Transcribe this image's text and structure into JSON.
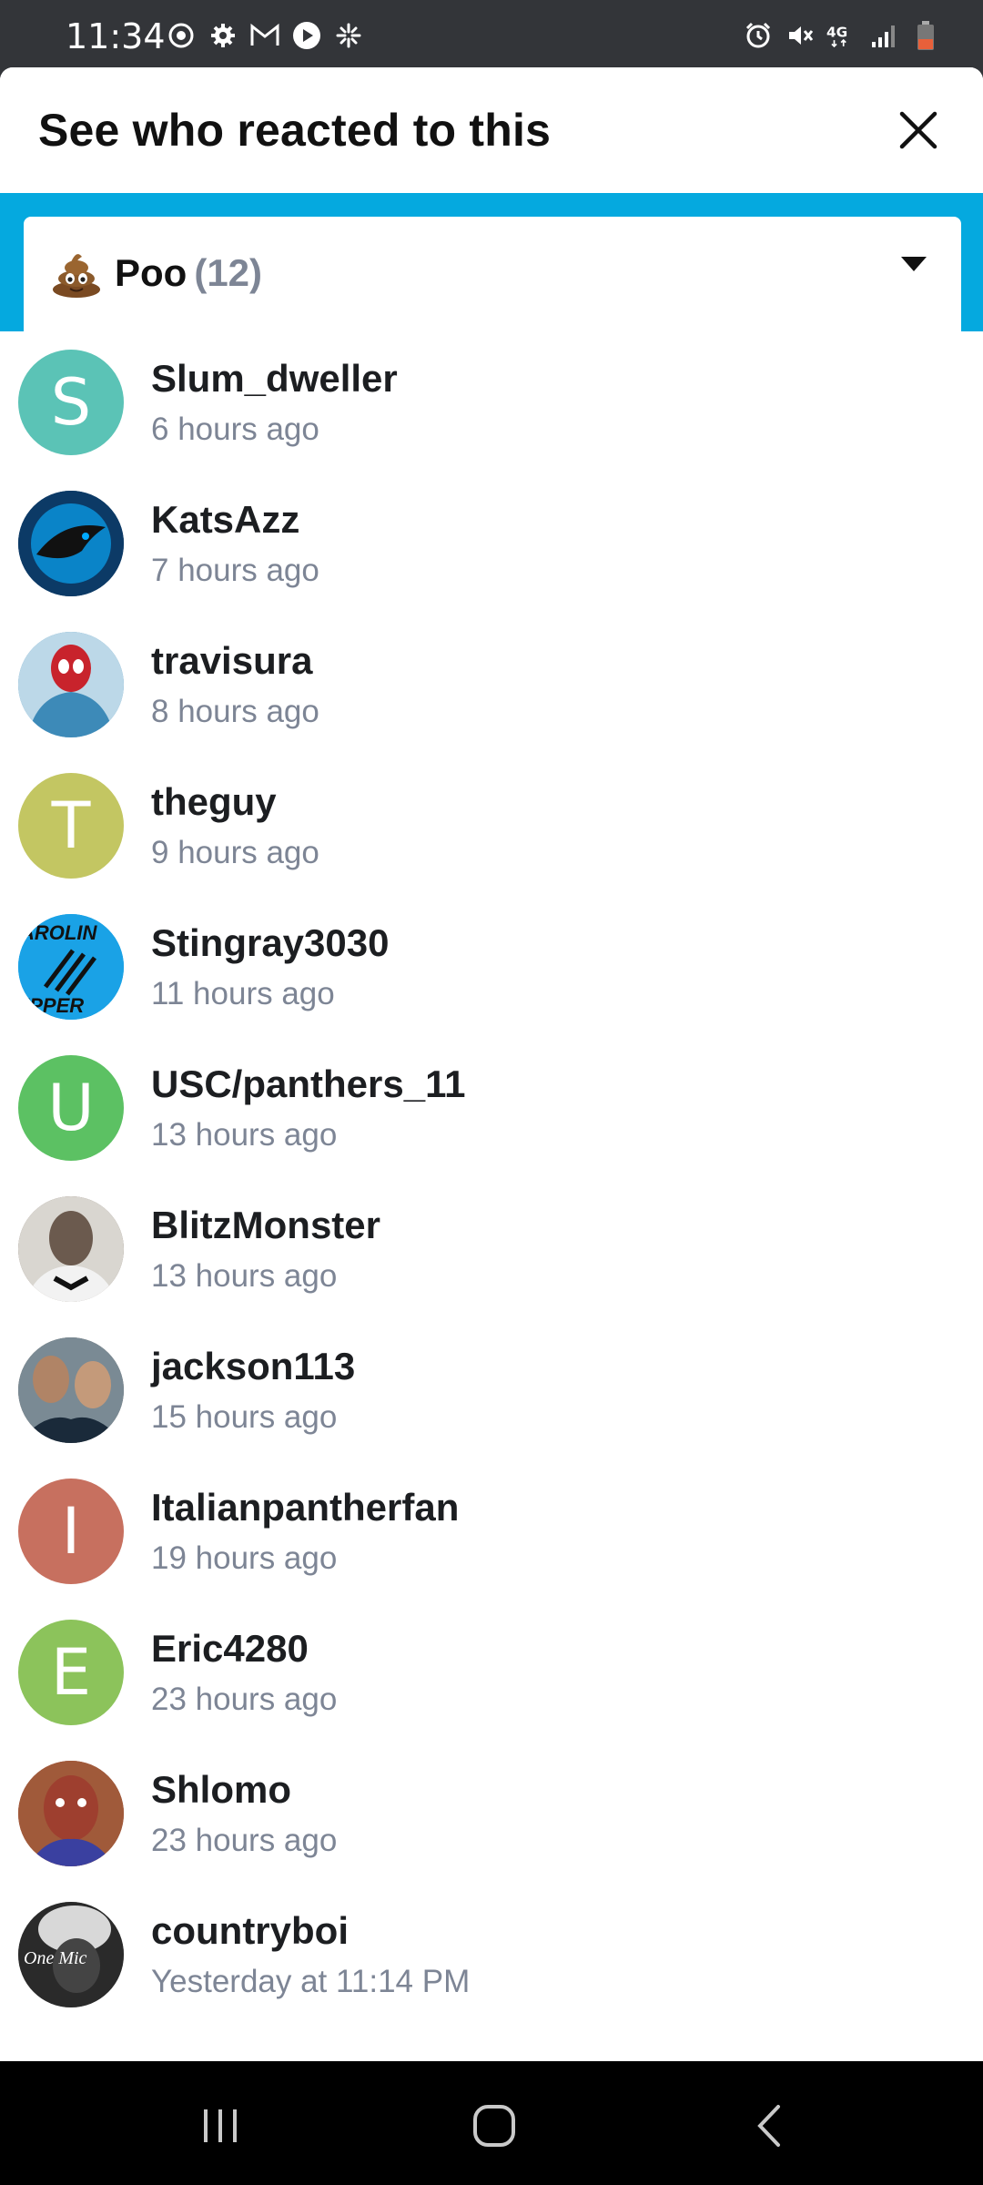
{
  "status_bar": {
    "time": "11:34",
    "left_icons": [
      "whatsapp-icon",
      "settings-icon",
      "gmail-icon",
      "play-icon",
      "sparkle-icon"
    ],
    "right_icons": [
      "alarm-icon",
      "mute-icon",
      "4g-icon",
      "signal-icon",
      "battery-icon"
    ]
  },
  "sheet": {
    "title": "See who reacted to this"
  },
  "reaction_filter": {
    "emoji": "poo-icon",
    "name": "Poo",
    "count": "(12)"
  },
  "reactors": [
    {
      "username": "Slum_dweller",
      "time": "6 hours ago",
      "initial": "S",
      "color": "#5bc3b6",
      "avatar": "letter"
    },
    {
      "username": "KatsAzz",
      "time": "7 hours ago",
      "initial": "",
      "color": "#0c3a66",
      "avatar": "panthers-logo"
    },
    {
      "username": "travisura",
      "time": "8 hours ago",
      "initial": "",
      "color": "#3d8ab8",
      "avatar": "spiderman"
    },
    {
      "username": "theguy",
      "time": "9 hours ago",
      "initial": "T",
      "color": "#c3c662",
      "avatar": "letter"
    },
    {
      "username": "Stingray3030",
      "time": "11 hours ago",
      "initial": "",
      "color": "#1aa2e6",
      "avatar": "carolina-clippers"
    },
    {
      "username": "USC/panthers_11",
      "time": "13 hours ago",
      "initial": "U",
      "color": "#5cc163",
      "avatar": "letter"
    },
    {
      "username": "BlitzMonster",
      "time": "13 hours ago",
      "initial": "",
      "color": "#6b5a4e",
      "avatar": "player-photo"
    },
    {
      "username": "jackson113",
      "time": "15 hours ago",
      "initial": "",
      "color": "#5a5550",
      "avatar": "players-photo"
    },
    {
      "username": "Italianpantherfan",
      "time": "19 hours ago",
      "initial": "I",
      "color": "#c7705f",
      "avatar": "letter"
    },
    {
      "username": "Eric4280",
      "time": "23 hours ago",
      "initial": "E",
      "color": "#8cc35b",
      "avatar": "letter"
    },
    {
      "username": "Shlomo",
      "time": "23 hours ago",
      "initial": "",
      "color": "#9e3f2f",
      "avatar": "face-photo"
    },
    {
      "username": "countryboi",
      "time": "Yesterday at 11:14 PM",
      "initial": "",
      "color": "#8a8a8a",
      "avatar": "one-mic"
    }
  ],
  "nav": {
    "buttons": [
      "recents-icon",
      "home-icon",
      "back-icon"
    ]
  }
}
